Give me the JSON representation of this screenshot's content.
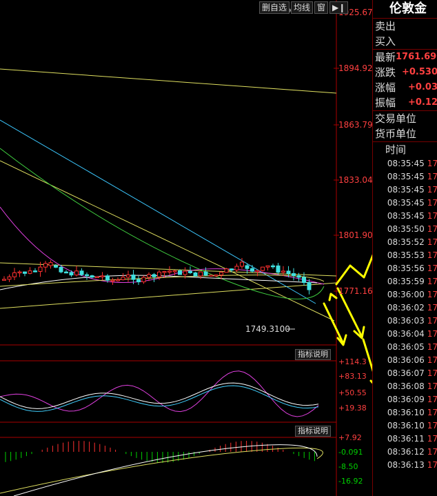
{
  "toolbar": {
    "delete_label": "删自选",
    "ma_label": "均线",
    "window_label": "窗"
  },
  "price_axis": [
    "1925.672",
    "1894.923",
    "1863.790",
    "1833.042",
    "1801.909",
    "1771.160"
  ],
  "low_label": "1749.3100",
  "indicator_button_1": "指标说明",
  "indicator_axis_1": [
    "+114.3",
    "+83.13",
    "+50.55",
    "+19.38"
  ],
  "indicator_button_2": "指标说明",
  "indicator_axis_2": [
    "+7.92",
    "-0.091",
    "-8.50",
    "-16.92"
  ],
  "panel": {
    "title": "伦敦金",
    "sell": "卖出",
    "buy": "买入",
    "latest_label": "最新",
    "latest_value": "1761.690",
    "change_label": "涨跌",
    "change_value": "+0.530",
    "pct_label": "涨幅",
    "pct_value": "+0.03",
    "amp_label": "振幅",
    "amp_value": "+0.12",
    "unit_label": "交易单位",
    "currency_label": "货币单位",
    "time_header": "时间",
    "ticks": [
      {
        "time": "08:35:45",
        "val": "17"
      },
      {
        "time": "08:35:45",
        "val": "17"
      },
      {
        "time": "08:35:45",
        "val": "17"
      },
      {
        "time": "08:35:45",
        "val": "17"
      },
      {
        "time": "08:35:45",
        "val": "17"
      },
      {
        "time": "08:35:50",
        "val": "17"
      },
      {
        "time": "08:35:52",
        "val": "17"
      },
      {
        "time": "08:35:53",
        "val": "17"
      },
      {
        "time": "08:35:56",
        "val": "17"
      },
      {
        "time": "08:35:59",
        "val": "17"
      },
      {
        "time": "08:36:00",
        "val": "17"
      },
      {
        "time": "08:36:02",
        "val": "17"
      },
      {
        "time": "08:36:03",
        "val": "17"
      },
      {
        "time": "08:36:04",
        "val": "17"
      },
      {
        "time": "08:36:05",
        "val": "17"
      },
      {
        "time": "08:36:06",
        "val": "17"
      },
      {
        "time": "08:36:07",
        "val": "17"
      },
      {
        "time": "08:36:08",
        "val": "17"
      },
      {
        "time": "08:36:09",
        "val": "17"
      },
      {
        "time": "08:36:10",
        "val": "17"
      },
      {
        "time": "08:36:10",
        "val": "17"
      },
      {
        "time": "08:36:11",
        "val": "17"
      },
      {
        "time": "08:36:12",
        "val": "17"
      },
      {
        "time": "08:36:13",
        "val": "17"
      }
    ]
  }
}
